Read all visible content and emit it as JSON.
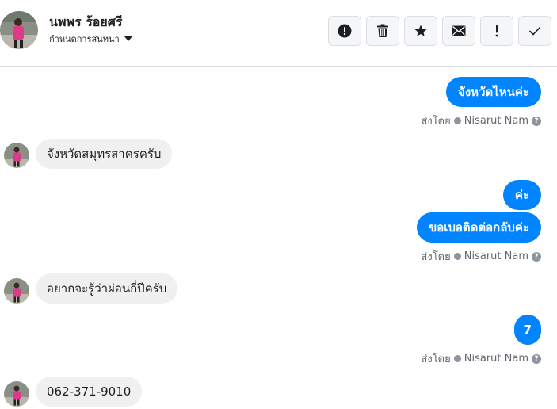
{
  "header": {
    "name": "นพพร ร้อยศรี",
    "subtitle": "กำหนดการสนทนา",
    "actions": [
      {
        "icon": "exclamation-circle-icon",
        "name": "report-button"
      },
      {
        "icon": "trash-icon",
        "name": "delete-button"
      },
      {
        "icon": "star-icon",
        "name": "star-button"
      },
      {
        "icon": "envelope-icon",
        "name": "mark-unread-button"
      },
      {
        "icon": "exclamation-icon",
        "name": "mark-spam-button"
      },
      {
        "icon": "check-icon",
        "name": "mark-done-button"
      }
    ]
  },
  "messages": {
    "m1": "จังหวัดไหนค่ะ",
    "m2": "จังหวัดสมุทรสาครครับ",
    "m3": "ค่ะ",
    "m4": "ขอเบอติดต่อกลับค่ะ",
    "m5": "อยากจะรู้ว่าผ่อนกี่ปีครับ",
    "m6": "7",
    "m7": "062-371-9010"
  },
  "sent_by": {
    "prefix": "ส่งโดย",
    "name": "Nisarut Nam"
  },
  "colors": {
    "outgoing": "#0084ff",
    "incoming": "#f0f0f0",
    "avatar_shirt": "#e0388a"
  }
}
